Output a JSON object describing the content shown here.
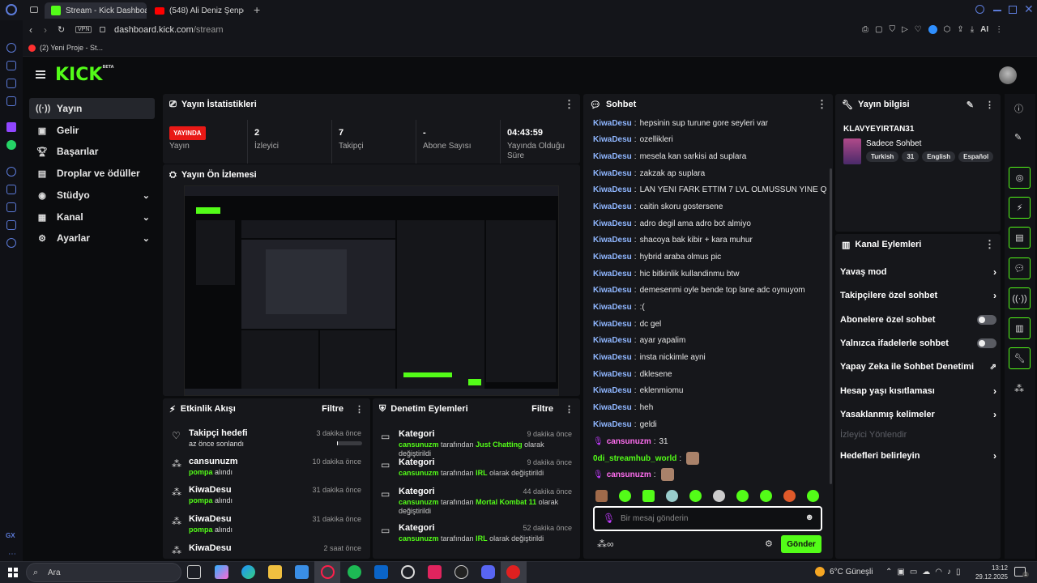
{
  "browser": {
    "tabs": [
      {
        "label": "Stream - Kick Dashboard",
        "active": true
      },
      {
        "label": "(548) Ali Deniz Şenpotuk",
        "active": false
      }
    ],
    "new_tab": "+",
    "vpn": "VPN",
    "url_host": "dashboard.kick.com",
    "url_path": "/stream",
    "bookmark": "(2) Yeni Proje - St...",
    "ai": "AI"
  },
  "kick": {
    "logo": "KICK",
    "logo_beta": "BETA",
    "nav": [
      {
        "label": "Yayın",
        "icon": "broadcast-icon",
        "active": true,
        "expand": false
      },
      {
        "label": "Gelir",
        "icon": "money-icon",
        "active": false,
        "expand": false
      },
      {
        "label": "Başarılar",
        "icon": "trophy-icon",
        "active": false,
        "expand": false
      },
      {
        "label": "Droplar ve ödüller",
        "icon": "gift-icon",
        "active": false,
        "expand": false
      },
      {
        "label": "Stüdyo",
        "icon": "studio-icon",
        "active": false,
        "expand": true
      },
      {
        "label": "Kanal",
        "icon": "channel-icon",
        "active": false,
        "expand": true
      },
      {
        "label": "Ayarlar",
        "icon": "gear-icon",
        "active": false,
        "expand": true
      }
    ],
    "stats": {
      "title": "Yayın İstatistikleri",
      "live_badge": "YAYINDA",
      "items": [
        {
          "value": "",
          "label": "Yayın"
        },
        {
          "value": "2",
          "label": "İzleyici"
        },
        {
          "value": "7",
          "label": "Takipçi"
        },
        {
          "value": "-",
          "label": "Abone Sayısı"
        },
        {
          "value": "04:43:59",
          "label": "Yayında Olduğu Süre"
        }
      ]
    },
    "preview": {
      "title": "Yayın Ön İzlemesi"
    },
    "activity": {
      "title": "Etkinlik Akışı",
      "filter": "Filtre",
      "rows": [
        {
          "name": "Takipçi hedefi",
          "sub": "az önce sonlandı",
          "time": "3 dakika önce",
          "icon": "heart-icon",
          "progress": 0.02
        },
        {
          "name": "cansunuzm",
          "sub": "pompa",
          "sub2": "alındı",
          "time": "10 dakika önce",
          "icon": "gift-icon"
        },
        {
          "name": "KiwaDesu",
          "sub": "pompa",
          "sub2": "alındı",
          "time": "31 dakika önce",
          "icon": "gift-icon"
        },
        {
          "name": "KiwaDesu",
          "sub": "pompa",
          "sub2": "alındı",
          "time": "31 dakika önce",
          "icon": "gift-icon"
        },
        {
          "name": "KiwaDesu",
          "sub": "",
          "sub2": "",
          "time": "2 saat önce",
          "icon": "gift-icon"
        }
      ]
    },
    "moderation": {
      "title": "Denetim Eylemleri",
      "filter": "Filtre",
      "rows": [
        {
          "name": "Kategori",
          "user": "cansunuzm",
          "mid": "tarafından",
          "cat": "Just Chatting",
          "end": "olarak değiştirildi",
          "time": "9 dakika önce"
        },
        {
          "name": "Kategori",
          "user": "cansunuzm",
          "mid": "tarafından",
          "cat": "IRL",
          "end": "olarak değiştirildi",
          "time": "9 dakika önce"
        },
        {
          "name": "Kategori",
          "user": "cansunuzm",
          "mid": "tarafından",
          "cat": "Mortal Kombat 11",
          "end": "olarak değiştirildi",
          "time": "44 dakika önce"
        },
        {
          "name": "Kategori",
          "user": "cansunuzm",
          "mid": "tarafından",
          "cat": "IRL",
          "end": "olarak değiştirildi",
          "time": "52 dakika önce"
        }
      ]
    },
    "chat": {
      "title": "Sohbet",
      "messages": [
        {
          "user": "KiwaDesu",
          "text": "hepsinin sup turune gore seyleri var"
        },
        {
          "user": "KiwaDesu",
          "text": "ozellikleri"
        },
        {
          "user": "KiwaDesu",
          "text": "mesela kan sarkisi ad suplara"
        },
        {
          "user": "KiwaDesu",
          "text": "zakzak ap suplara"
        },
        {
          "user": "KiwaDesu",
          "text": "LAN YENI FARK ETTIM 7 LVL OLMUSSUN YINE Q YOK"
        },
        {
          "user": "KiwaDesu",
          "text": "caitin skoru gostersene"
        },
        {
          "user": "KiwaDesu",
          "text": "adro degil ama adro bot almiyo"
        },
        {
          "user": "KiwaDesu",
          "text": "shacoya bak kibir + kara muhur"
        },
        {
          "user": "KiwaDesu",
          "text": "hybrid araba olmus pic"
        },
        {
          "user": "KiwaDesu",
          "text": "hic bitkinlik kullandinmu btw"
        },
        {
          "user": "KiwaDesu",
          "text": "demesenmi oyle bende top lane adc oynuyom"
        },
        {
          "user": "KiwaDesu",
          "text": ":("
        },
        {
          "user": "KiwaDesu",
          "text": "dc gel"
        },
        {
          "user": "KiwaDesu",
          "text": "ayar yapalim"
        },
        {
          "user": "KiwaDesu",
          "text": "insta nickimle ayni"
        },
        {
          "user": "KiwaDesu",
          "text": "dklesene"
        },
        {
          "user": "KiwaDesu",
          "text": "eklenmiomu"
        },
        {
          "user": "KiwaDesu",
          "text": "heh"
        },
        {
          "user": "KiwaDesu",
          "text": "geldi"
        },
        {
          "user": "cansunuzm",
          "text": "31",
          "style": "pink"
        },
        {
          "user": "0di_streamhub_world",
          "text": "",
          "style": "grn",
          "emote": true
        },
        {
          "user": "cansunuzm",
          "text": "",
          "style": "pink",
          "emote": true
        }
      ],
      "placeholder": "Bir mesaj gönderin",
      "send": "Gönder"
    },
    "info": {
      "title": "Yayın bilgisi",
      "stream_title": "KLAVYEYIRTAN31",
      "category": "Sadece Sohbet",
      "tags": [
        "Turkish",
        "31",
        "English",
        "Español"
      ]
    },
    "channel_actions": {
      "title": "Kanal Eylemleri",
      "items": [
        {
          "label": "Yavaş mod",
          "kind": "arrow"
        },
        {
          "label": "Takipçilere özel sohbet",
          "kind": "arrow"
        },
        {
          "label": "Abonelere özel sohbet",
          "kind": "toggle"
        },
        {
          "label": "Yalnızca ifadelerle sohbet",
          "kind": "toggle"
        },
        {
          "label": "Yapay Zeka ile Sohbet Denetimi",
          "kind": "external"
        },
        {
          "label": "Hesap yaşı kısıtlaması",
          "kind": "arrow"
        },
        {
          "label": "Yasaklanmış kelimeler",
          "kind": "arrow"
        },
        {
          "label": "İzleyici Yönlendir",
          "kind": "disabled"
        },
        {
          "label": "Hedefleri belirleyin",
          "kind": "arrow"
        }
      ]
    }
  },
  "taskbar": {
    "search": "Ara",
    "weather": "6°C",
    "weather_text": "Güneşli",
    "time": "13:12",
    "date": "29.12.2025",
    "notifications": "1"
  },
  "colors": {
    "accent": "#53fc18",
    "live": "#e91916"
  }
}
